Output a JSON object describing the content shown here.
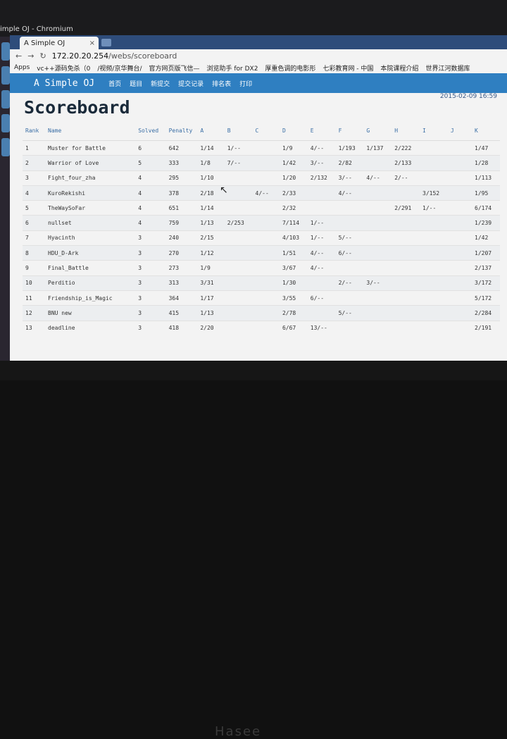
{
  "window_title": "imple OJ - Chromium",
  "tab": {
    "title": "A Simple OJ",
    "close": "×"
  },
  "address": {
    "host": "172.20.20.254",
    "path": "/webs/scoreboard"
  },
  "bookmarks": [
    "Apps",
    "vc++源码免杀（0",
    "/视频/京华舞台/",
    "官方网页版飞信—",
    "浏览助手 for DX2",
    "厚重色调的电影形",
    "七彩教育网 - 中国",
    "本院课程介绍",
    "世界江河数据库"
  ],
  "nav": {
    "brand": "A Simple OJ",
    "links": [
      "首页",
      "题目",
      "新提交",
      "提交记录",
      "排名表",
      "打印"
    ]
  },
  "page": {
    "title": "Scoreboard",
    "clock": "2015-02-09  16:59"
  },
  "columns": [
    "Rank",
    "Name",
    "Solved",
    "Penalty",
    "A",
    "B",
    "C",
    "D",
    "E",
    "F",
    "G",
    "H",
    "I",
    "J",
    "K"
  ],
  "rows": [
    [
      "1",
      "Muster for Battle",
      "6",
      "642",
      "1/14",
      "1/--",
      "",
      "1/9",
      "4/--",
      "1/193",
      "1/137",
      "2/222",
      "",
      "",
      "1/47"
    ],
    [
      "2",
      "Warrior of Love",
      "5",
      "333",
      "1/8",
      "7/--",
      "",
      "1/42",
      "3/--",
      "2/82",
      "",
      "2/133",
      "",
      "",
      "1/28"
    ],
    [
      "3",
      "Fight_four_zha",
      "4",
      "295",
      "1/10",
      "",
      "",
      "1/20",
      "2/132",
      "3/--",
      "4/--",
      "2/--",
      "",
      "",
      "1/113"
    ],
    [
      "4",
      "KuroRekishi",
      "4",
      "378",
      "2/18",
      "",
      "4/--",
      "2/33",
      "",
      "4/--",
      "",
      "",
      "3/152",
      "",
      "1/95"
    ],
    [
      "5",
      "TheWaySoFar",
      "4",
      "651",
      "1/14",
      "",
      "",
      "2/32",
      "",
      "",
      "",
      "2/291",
      "1/--",
      "",
      "6/174"
    ],
    [
      "6",
      "nullset",
      "4",
      "759",
      "1/13",
      "2/253",
      "",
      "7/114",
      "1/--",
      "",
      "",
      "",
      "",
      "",
      "1/239"
    ],
    [
      "7",
      "Hyacinth",
      "3",
      "240",
      "2/15",
      "",
      "",
      "4/103",
      "1/--",
      "5/--",
      "",
      "",
      "",
      "",
      "1/42"
    ],
    [
      "8",
      "HDU_D-Ark",
      "3",
      "270",
      "1/12",
      "",
      "",
      "1/51",
      "4/--",
      "6/--",
      "",
      "",
      "",
      "",
      "1/207"
    ],
    [
      "9",
      "Final_Battle",
      "3",
      "273",
      "1/9",
      "",
      "",
      "3/67",
      "4/--",
      "",
      "",
      "",
      "",
      "",
      "2/137"
    ],
    [
      "10",
      "Perditio",
      "3",
      "313",
      "3/31",
      "",
      "",
      "1/30",
      "",
      "2/--",
      "3/--",
      "",
      "",
      "",
      "3/172"
    ],
    [
      "11",
      "Friendship_is_Magic",
      "3",
      "364",
      "1/17",
      "",
      "",
      "3/55",
      "6/--",
      "",
      "",
      "",
      "",
      "",
      "5/172"
    ],
    [
      "12",
      "BNU new",
      "3",
      "415",
      "1/13",
      "",
      "",
      "2/78",
      "",
      "5/--",
      "",
      "",
      "",
      "",
      "2/284"
    ],
    [
      "13",
      "deadline",
      "3",
      "418",
      "2/20",
      "",
      "",
      "6/67",
      "13/--",
      "",
      "",
      "",
      "",
      "",
      "2/191"
    ]
  ],
  "taskbar_brand": "Hasee"
}
